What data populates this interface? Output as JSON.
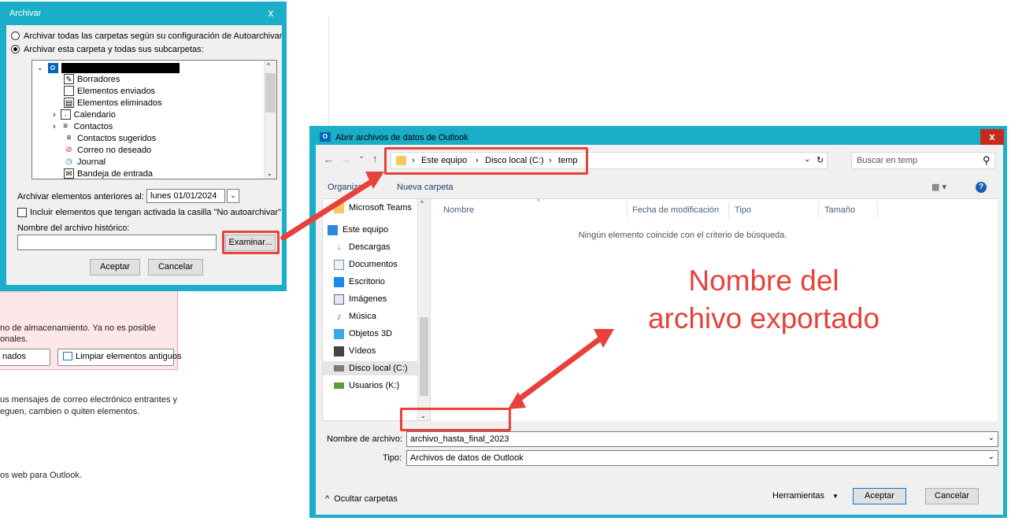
{
  "background": {
    "storage_line1": "no de almacenamiento. Ya no es posible",
    "storage_line2": "onales.",
    "btn_partial": "nados",
    "btn_cleanup": "Limpiar elementos antiguos",
    "rules_line1": "us mensajes de correo electrónico entrantes y",
    "rules_line2": "eguen, cambien o quiten elementos.",
    "addins_line": "os web para Outlook."
  },
  "archive_dialog": {
    "title": "Archivar",
    "close": "x",
    "option_all": "Archivar todas las carpetas según su configuración de Autoarchivar",
    "option_this": "Archivar esta carpeta y todas sus subcarpetas:",
    "folders": [
      "Borradores",
      "Elementos enviados",
      "Elementos eliminados",
      "Calendario",
      "Contactos",
      "Contactos sugeridos",
      "Correo no deseado",
      "Journal",
      "Bandeja de entrada"
    ],
    "older_than_label": "Archivar elementos anteriores al:",
    "older_than_value": "lunes 01/01/2024",
    "include_label": "Incluir elementos que tengan activada la casilla \"No autoarchivar\"",
    "file_label": "Nombre del archivo histórico:",
    "file_value": "",
    "browse": "Examinar...",
    "ok": "Aceptar",
    "cancel": "Cancelar"
  },
  "open_dialog": {
    "title": "Abrir archivos de datos de Outlook",
    "close": "x",
    "path": [
      "Este equipo",
      "Disco local (C:)",
      "temp"
    ],
    "search_placeholder": "Buscar en temp",
    "organize": "Organizar",
    "new_folder": "Nueva carpeta",
    "nav_items": [
      "Microsoft Teams",
      "Este equipo",
      "Descargas",
      "Documentos",
      "Escritorio",
      "Imágenes",
      "Música",
      "Objetos 3D",
      "Vídeos",
      "Disco local (C:)",
      "Usuarios (K:)"
    ],
    "columns": [
      "Nombre",
      "Fecha de modificación",
      "Tipo",
      "Tamaño"
    ],
    "empty_message": "Ningún elemento coincide con el criterio de búsqueda.",
    "filename_label": "Nombre de archivo:",
    "filename_value": "archivo_hasta_final_2023",
    "type_label": "Tipo:",
    "type_value": "Archivos de datos de Outlook",
    "hide_folders": "Ocultar carpetas",
    "tools": "Herramientas",
    "ok": "Aceptar",
    "cancel": "Cancelar"
  },
  "annotation": {
    "line1": "Nombre del",
    "line2": "archivo exportado",
    "color": "#e8413b"
  }
}
